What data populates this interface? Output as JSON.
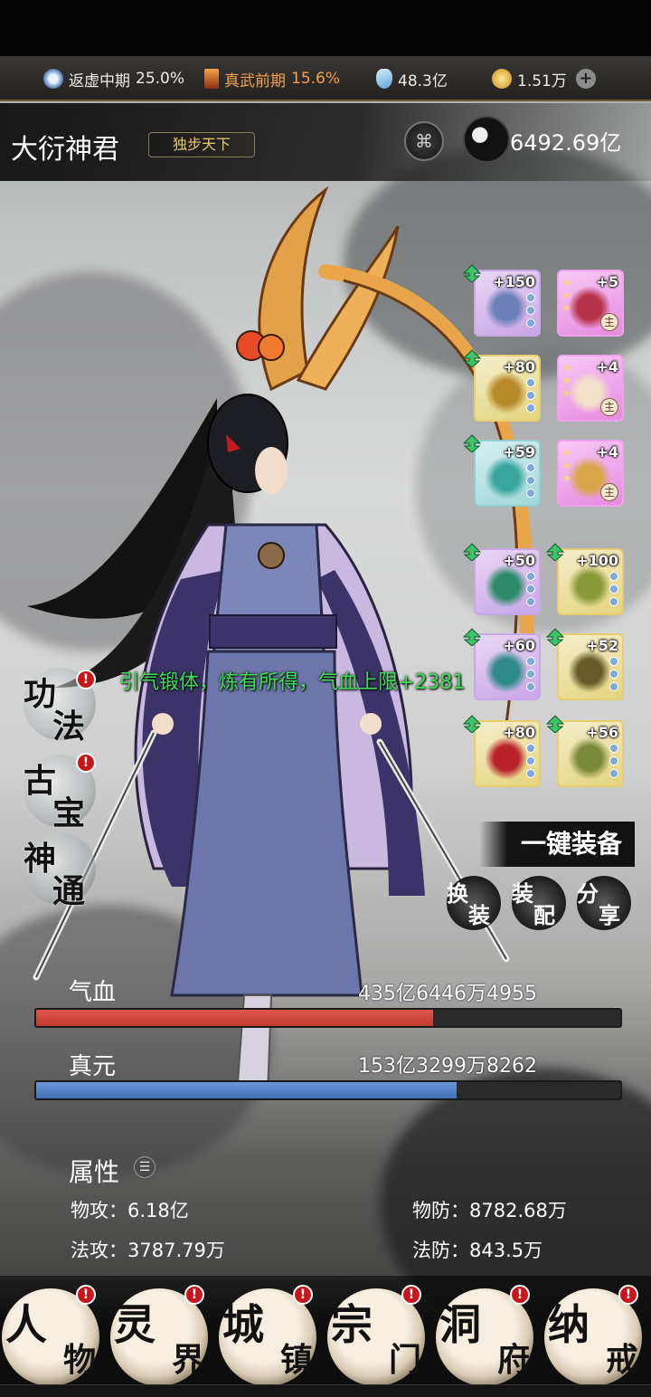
{
  "resources": {
    "realm_1": {
      "name": "返虚中期",
      "value": "25.0%"
    },
    "realm_2": {
      "name": "真武前期",
      "value": "15.6%"
    },
    "crystals": "48.3亿",
    "coins": "1.51万",
    "add_icon": "plus-icon"
  },
  "character": {
    "name": "大衍神君",
    "title": "独步天下",
    "power": "6492.69亿"
  },
  "equipment": [
    {
      "level": "+150",
      "rarity": "purple",
      "upgrade": true,
      "slot": "weapon"
    },
    {
      "level": "+5",
      "rarity": "pink",
      "upgrade": false,
      "slot": "relic",
      "main": "主",
      "stars": 3
    },
    {
      "level": "+80",
      "rarity": "gold",
      "upgrade": true,
      "slot": "armor"
    },
    {
      "level": "+4",
      "rarity": "pink",
      "upgrade": false,
      "slot": "lotus",
      "main": "主",
      "stars": 3
    },
    {
      "level": "+59",
      "rarity": "teal",
      "upgrade": true,
      "slot": "ring"
    },
    {
      "level": "+4",
      "rarity": "pink",
      "upgrade": false,
      "slot": "scroll",
      "main": "主",
      "stars": 3
    },
    {
      "level": "+50",
      "rarity": "purple",
      "upgrade": true,
      "slot": "beast"
    },
    {
      "level": "+100",
      "rarity": "gold",
      "upgrade": true,
      "slot": "arrows"
    },
    {
      "level": "+60",
      "rarity": "purple",
      "upgrade": true,
      "slot": "beast2"
    },
    {
      "level": "+52",
      "rarity": "gold",
      "upgrade": true,
      "slot": "bird"
    },
    {
      "level": "+80",
      "rarity": "gold",
      "upgrade": true,
      "slot": "talisman"
    },
    {
      "level": "+56",
      "rarity": "gold",
      "upgrade": true,
      "slot": "arrows2"
    }
  ],
  "toast": "引气锻体，炼有所得，气血上限+2381",
  "side_menu": [
    {
      "c1": "功",
      "c2": "法",
      "alert": true
    },
    {
      "c1": "古",
      "c2": "宝",
      "alert": true
    },
    {
      "c1": "神",
      "c2": "通",
      "alert": false
    }
  ],
  "alert_mark": "!",
  "one_key_equip": "一键装备",
  "small_buttons": [
    {
      "c1": "换",
      "c2": "装"
    },
    {
      "c1": "装",
      "c2": "配"
    },
    {
      "c1": "分",
      "c2": "享"
    }
  ],
  "hp": {
    "label": "气血",
    "value": "435亿6446万4955",
    "fill": 0.68
  },
  "mp": {
    "label": "真元",
    "value": "153亿3299万8262",
    "fill": 0.72
  },
  "attributes": {
    "title": "属性",
    "phys_atk": {
      "label": "物攻：",
      "value": "6.18亿"
    },
    "phys_def": {
      "label": "物防：",
      "value": "8782.68万"
    },
    "mag_atk": {
      "label": "法攻：",
      "value": "3787.79万"
    },
    "mag_def": {
      "label": "法防：",
      "value": "843.5万"
    }
  },
  "nav": [
    {
      "c1": "人",
      "c2": "物",
      "alert": true
    },
    {
      "c1": "灵",
      "c2": "界",
      "alert": true
    },
    {
      "c1": "城",
      "c2": "镇",
      "alert": true
    },
    {
      "c1": "宗",
      "c2": "门",
      "alert": true
    },
    {
      "c1": "洞",
      "c2": "府",
      "alert": true
    },
    {
      "c1": "纳",
      "c2": "戒",
      "alert": true
    }
  ],
  "colors": {
    "hp": "#c0392f",
    "mp": "#3f6fb8",
    "accent": "#f3a24a",
    "toast": "#3ddc55"
  }
}
